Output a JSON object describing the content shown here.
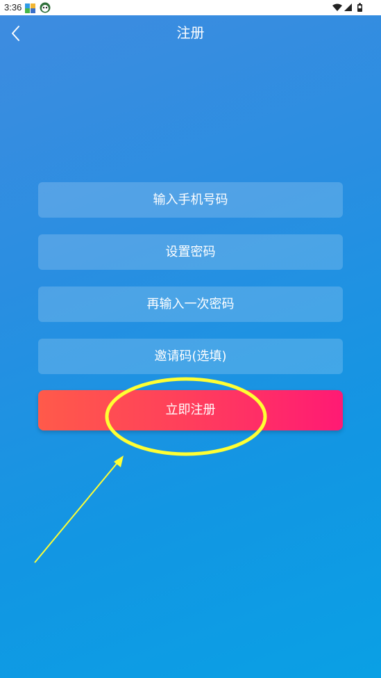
{
  "status_bar": {
    "time": "3:36",
    "icons": [
      "app-notification-icon",
      "app-notification-icon-2",
      "wifi-icon",
      "cell-signal-icon",
      "battery-icon"
    ]
  },
  "header": {
    "title": "注册",
    "back_icon": "chevron-left-icon"
  },
  "form": {
    "phone_placeholder": "输入手机号码",
    "password_placeholder": "设置密码",
    "confirm_placeholder": "再输入一次密码",
    "invite_placeholder": "邀请码(选填)",
    "submit_label": "立即注册"
  },
  "colors": {
    "background_start": "#3f8ce0",
    "background_end": "#0aa0e4",
    "button_start": "#ff5a4a",
    "button_end": "#ff1a74",
    "annotation": "#ffff33"
  }
}
